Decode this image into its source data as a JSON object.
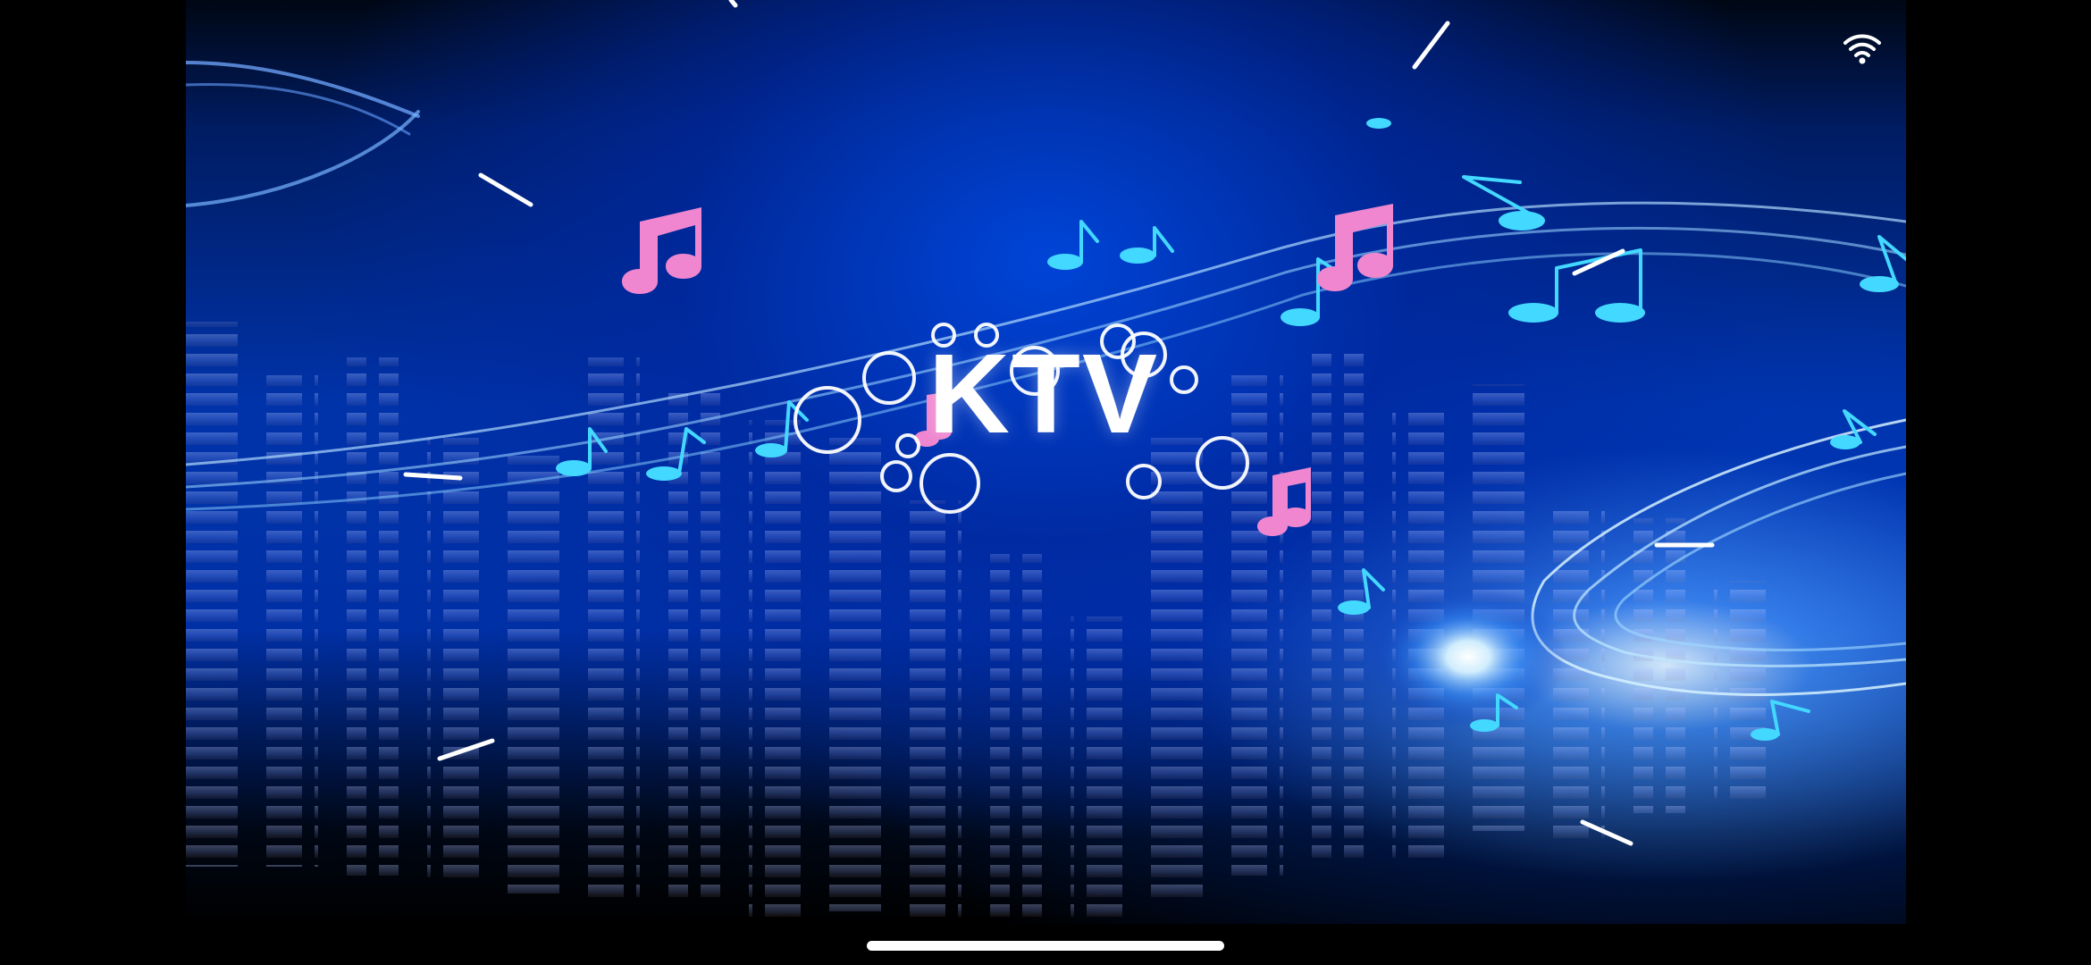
{
  "app": {
    "logo_text": "KTV"
  },
  "status_bar": {
    "wifi_icon": "wifi-icon"
  },
  "decor": {
    "music_note_icon": "music-note-icon",
    "equalizer_icon": "equalizer-bars-icon",
    "bubble_icon": "bubble-icon",
    "sparkle_icon": "sparkle-line-icon"
  },
  "colors": {
    "background": "#002a9c",
    "accent_pink": "#f06bc4",
    "accent_cyan": "#4fe6ff",
    "text": "#ffffff"
  }
}
